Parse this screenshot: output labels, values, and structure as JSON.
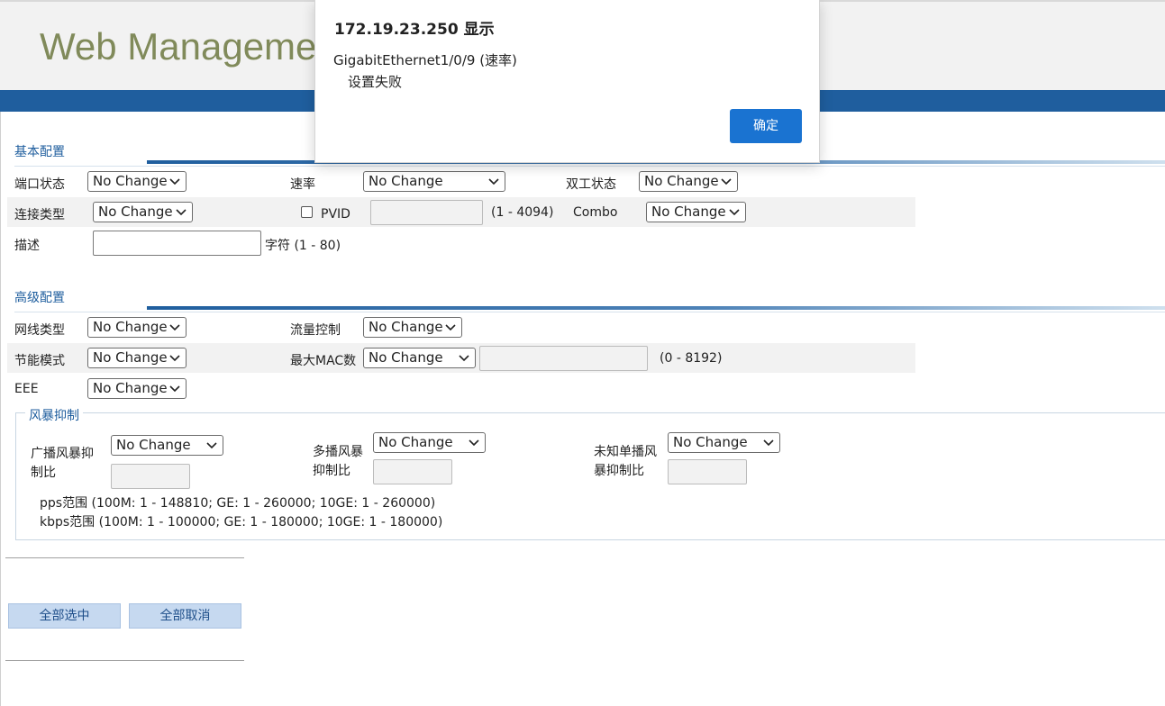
{
  "header": {
    "title": "Web Management"
  },
  "basic": {
    "title": "基本配置",
    "port_status_label": "端口状态",
    "port_status_value": "No Change",
    "speed_label": "速率",
    "speed_value": "No Change",
    "duplex_label": "双工状态",
    "duplex_value": "No Change",
    "link_type_label": "连接类型",
    "link_type_value": "No Change",
    "pvid_label": "PVID",
    "pvid_value": "",
    "pvid_range": "(1 - 4094)",
    "combo_label": "Combo",
    "combo_value": "No Change",
    "desc_label": "描述",
    "desc_value": "",
    "desc_range": "字符 (1 - 80)"
  },
  "advanced": {
    "title": "高级配置",
    "cable_type_label": "网线类型",
    "cable_type_value": "No Change",
    "flow_control_label": "流量控制",
    "flow_control_value": "No Change",
    "energy_mode_label": "节能模式",
    "energy_mode_value": "No Change",
    "max_mac_label": "最大MAC数",
    "max_mac_value": "No Change",
    "max_mac_input": "",
    "max_mac_range": "(0 - 8192)",
    "eee_label": "EEE",
    "eee_value": "No Change"
  },
  "storm": {
    "legend": "风暴抑制",
    "broadcast_label_1": "广播风暴抑",
    "broadcast_label_2": "制比",
    "broadcast_value": "No Change",
    "multicast_label_1": "多播风暴",
    "multicast_label_2": "抑制比",
    "multicast_value": "No Change",
    "unknown_label_1": "未知单播风",
    "unknown_label_2": "暴抑制比",
    "unknown_value": "No Change",
    "pps_range": "pps范围 (100M: 1 - 148810; GE: 1 - 260000; 10GE: 1 - 260000)",
    "kbps_range": "kbps范围 (100M: 1 - 100000; GE: 1 - 180000; 10GE: 1 - 180000)"
  },
  "actions": {
    "select_all": "全部选中",
    "deselect_all": "全部取消"
  },
  "dialog": {
    "title": "172.19.23.250 显示",
    "message_line1": "GigabitEthernet1/0/9 (速率)",
    "message_line2": "设置失败",
    "ok_label": "确定"
  },
  "colors": {
    "header_bar": "#1f5e9e",
    "section_title": "#1f5e9e",
    "dialog_button": "#1a73d1"
  }
}
